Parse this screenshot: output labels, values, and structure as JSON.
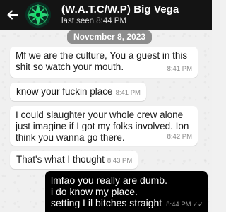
{
  "header": {
    "back": "←",
    "contact_name": "(W.A.T.C/W.P) Big Vega",
    "status": "last seen 8:44 PM"
  },
  "date_divider": "November 8, 2023",
  "messages": [
    {
      "direction": "incoming",
      "text": "Mf we are the culture, You a guest in this shit so watch your mouth.",
      "time": "8:41 PM"
    },
    {
      "direction": "incoming",
      "text": "know your fuckin place",
      "time": "8:41 PM"
    },
    {
      "direction": "incoming",
      "text": "I could slaughter your whole crew alone just imagine if I got my folks involved. Ion think you wanna go there.",
      "time": "8:42 PM"
    },
    {
      "direction": "incoming",
      "text": "That's what I thought",
      "time": "8:43 PM"
    },
    {
      "direction": "outgoing",
      "lines": [
        "lmfao you really are dumb.",
        "i do know my place.",
        "setting Lil bitches straight"
      ],
      "time": "8:44 PM",
      "ticks": "✓✓"
    }
  ],
  "colors": {
    "header_bg": "#141414",
    "chat_bg": "#f0f0f0",
    "incoming_bubble": "#ffffff",
    "outgoing_bubble": "#000000",
    "date_badge": "#8d8d8d"
  },
  "icons": {
    "back": "arrow-left-icon",
    "avatar": "green-emblem-avatar"
  }
}
